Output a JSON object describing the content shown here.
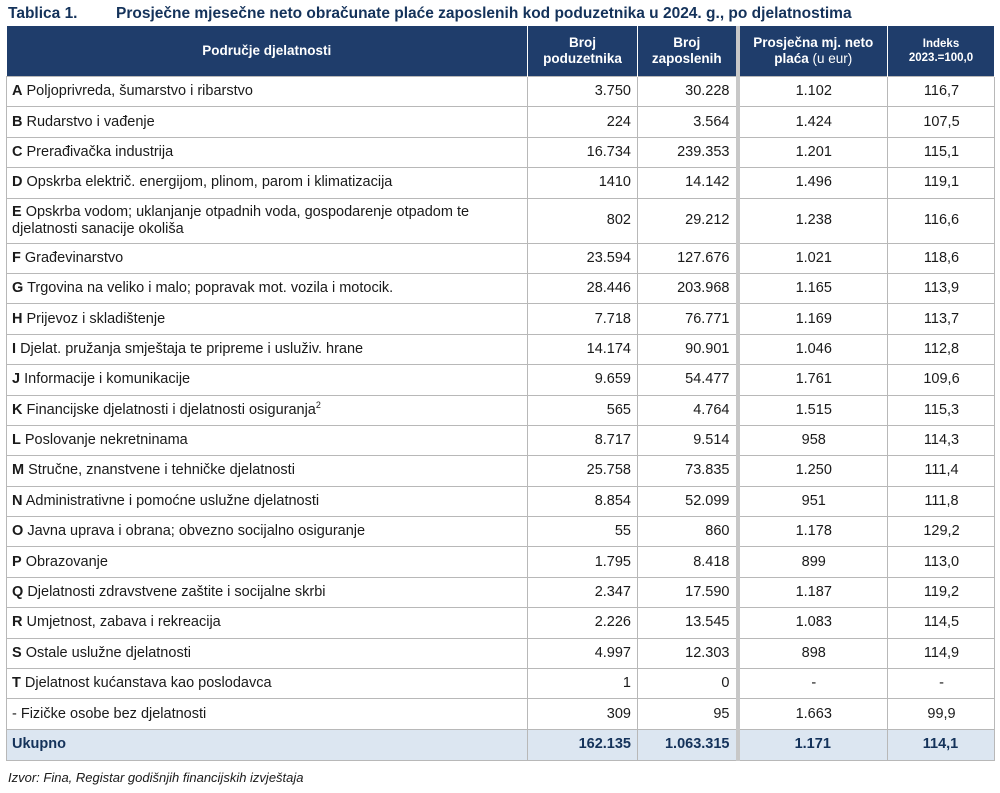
{
  "title": {
    "label": "Tablica 1.",
    "text": "Prosječne mjesečne neto obračunate plaće zaposlenih kod poduzetnika u 2024. g., po djelatnostima"
  },
  "header": {
    "col_name": "Područje djelatnosti",
    "col_poduzetnika_l1": "Broj",
    "col_poduzetnika_l2": "poduzetnika",
    "col_zaposlenih_l1": "Broj",
    "col_zaposlenih_l2": "zaposlenih",
    "col_placa_l1": "Prosječna mj. neto",
    "col_placa_l2": "plaća",
    "col_placa_unit": "(u eur)",
    "col_indeks_l1": "Indeks",
    "col_indeks_l2": "2023.=100,0"
  },
  "rows": [
    {
      "letter": "A",
      "name": "Poljoprivreda, šumarstvo i ribarstvo",
      "poduzetnika": "3.750",
      "zaposlenih": "30.228",
      "placa": "1.102",
      "indeks": "116,7"
    },
    {
      "letter": "B",
      "name": "Rudarstvo i vađenje",
      "poduzetnika": "224",
      "zaposlenih": "3.564",
      "placa": "1.424",
      "indeks": "107,5"
    },
    {
      "letter": "C",
      "name": "Prerađivačka industrija",
      "poduzetnika": "16.734",
      "zaposlenih": "239.353",
      "placa": "1.201",
      "indeks": "115,1"
    },
    {
      "letter": "D",
      "name": "Opskrba električ. energijom, plinom, parom i klimatizacija",
      "poduzetnika": "1410",
      "zaposlenih": "14.142",
      "placa": "1.496",
      "indeks": "119,1"
    },
    {
      "letter": "E",
      "name": "Opskrba vodom; uklanjanje otpadnih voda, gospodarenje otpadom te djelatnosti sanacije okoliša",
      "poduzetnika": "802",
      "zaposlenih": "29.212",
      "placa": "1.238",
      "indeks": "116,6"
    },
    {
      "letter": "F",
      "name": "Građevinarstvo",
      "poduzetnika": "23.594",
      "zaposlenih": "127.676",
      "placa": "1.021",
      "indeks": "118,6"
    },
    {
      "letter": "G",
      "name": "Trgovina na veliko i malo; popravak mot. vozila i motocik.",
      "poduzetnika": "28.446",
      "zaposlenih": "203.968",
      "placa": "1.165",
      "indeks": "113,9"
    },
    {
      "letter": "H",
      "name": "Prijevoz i skladištenje",
      "poduzetnika": "7.718",
      "zaposlenih": "76.771",
      "placa": "1.169",
      "indeks": "113,7"
    },
    {
      "letter": "I",
      "name": "Djelat. pružanja smještaja te pripreme i usluživ. hrane",
      "poduzetnika": "14.174",
      "zaposlenih": "90.901",
      "placa": "1.046",
      "indeks": "112,8"
    },
    {
      "letter": "J",
      "name": "Informacije i komunikacije",
      "poduzetnika": "9.659",
      "zaposlenih": "54.477",
      "placa": "1.761",
      "indeks": "109,6"
    },
    {
      "letter": "K",
      "name": "Financijske djelatnosti i djelatnosti osiguranja",
      "sup": "2",
      "poduzetnika": "565",
      "zaposlenih": "4.764",
      "placa": "1.515",
      "indeks": "115,3"
    },
    {
      "letter": "L",
      "name": "Poslovanje nekretninama",
      "poduzetnika": "8.717",
      "zaposlenih": "9.514",
      "placa": "958",
      "indeks": "114,3"
    },
    {
      "letter": "M",
      "name": "Stručne, znanstvene i tehničke djelatnosti",
      "poduzetnika": "25.758",
      "zaposlenih": "73.835",
      "placa": "1.250",
      "indeks": "111,4"
    },
    {
      "letter": "N",
      "name": "Administrativne i pomoćne uslužne djelatnosti",
      "poduzetnika": "8.854",
      "zaposlenih": "52.099",
      "placa": "951",
      "indeks": "111,8"
    },
    {
      "letter": "O",
      "name": "Javna uprava i obrana; obvezno socijalno osiguranje",
      "poduzetnika": "55",
      "zaposlenih": "860",
      "placa": "1.178",
      "indeks": "129,2"
    },
    {
      "letter": "P",
      "name": "Obrazovanje",
      "poduzetnika": "1.795",
      "zaposlenih": "8.418",
      "placa": "899",
      "indeks": "113,0"
    },
    {
      "letter": "Q",
      "name": "Djelatnosti zdravstvene zaštite i socijalne skrbi",
      "poduzetnika": "2.347",
      "zaposlenih": "17.590",
      "placa": "1.187",
      "indeks": "119,2"
    },
    {
      "letter": "R",
      "name": "Umjetnost, zabava i rekreacija",
      "poduzetnika": "2.226",
      "zaposlenih": "13.545",
      "placa": "1.083",
      "indeks": "114,5"
    },
    {
      "letter": "S",
      "name": "Ostale uslužne djelatnosti",
      "poduzetnika": "4.997",
      "zaposlenih": "12.303",
      "placa": "898",
      "indeks": "114,9"
    },
    {
      "letter": "T",
      "name": "Djelatnost kućanstava kao poslodavca",
      "poduzetnika": "1",
      "zaposlenih": "0",
      "placa": "-",
      "indeks": "-"
    },
    {
      "letter": "",
      "name": "- Fizičke osobe bez djelatnosti",
      "poduzetnika": "309",
      "zaposlenih": "95",
      "placa": "1.663",
      "indeks": "99,9"
    }
  ],
  "total": {
    "label": "Ukupno",
    "poduzetnika": "162.135",
    "zaposlenih": "1.063.315",
    "placa": "1.171",
    "indeks": "114,1"
  },
  "source": "Izvor: Fina, Registar godišnjih financijskih izvještaja"
}
